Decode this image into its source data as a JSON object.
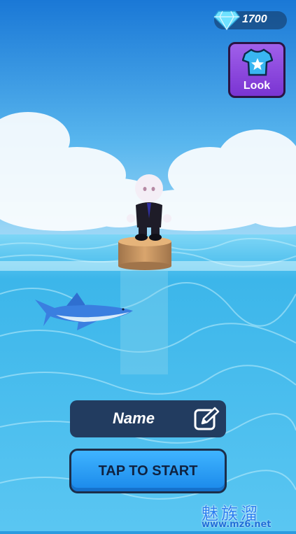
{
  "hud": {
    "gem_icon": "diamond-icon",
    "gem_count": "1700",
    "look_icon": "tshirt-star-icon",
    "look_label": "Look"
  },
  "name_field": {
    "label": "Name",
    "edit_icon": "pencil-square-icon"
  },
  "start_button": {
    "label": "TAP TO START"
  },
  "watermark": {
    "logo_text": "魅族溜",
    "url": "www.mz6.net"
  },
  "colors": {
    "sky": "#2f98e6",
    "sea": "#3ab4ee",
    "look_button": "#8a44dc",
    "name_field": "#223c60",
    "start_button": "#2a9cf6"
  }
}
